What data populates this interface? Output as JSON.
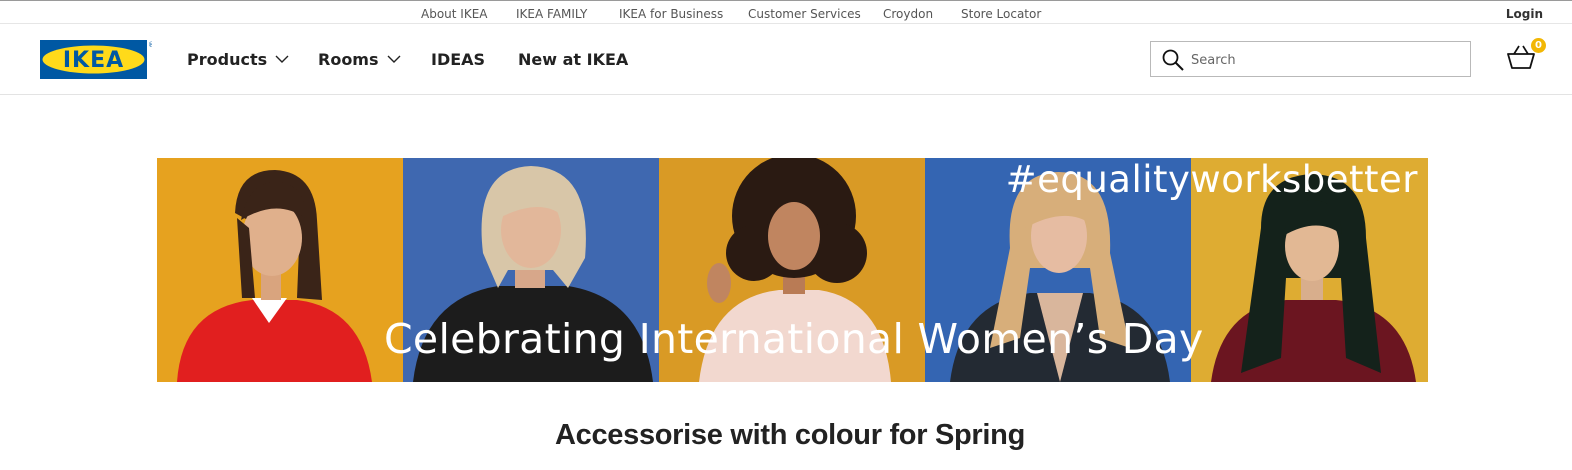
{
  "utility_nav": {
    "links": [
      "About IKEA",
      "IKEA FAMILY",
      "IKEA for Business",
      "Customer Services",
      "Croydon",
      "Store Locator"
    ],
    "login_label": "Login"
  },
  "header": {
    "logo_text": "IKEA",
    "nav": [
      {
        "label": "Products",
        "has_dropdown": true
      },
      {
        "label": "Rooms",
        "has_dropdown": true
      },
      {
        "label": "IDEAS",
        "has_dropdown": false
      },
      {
        "label": "New at IKEA",
        "has_dropdown": false
      }
    ],
    "search": {
      "placeholder": "Search",
      "value": ""
    },
    "cart": {
      "count": "0",
      "icon": "shopping-basket-icon"
    }
  },
  "hero": {
    "hashtag": "#equalityworksbetter",
    "caption": "Celebrating International Women’s Day",
    "panel_colors": [
      "#e6a21f",
      "#3f68b0",
      "#d99a25",
      "#3465b2",
      "#deac32"
    ]
  },
  "section": {
    "title": "Accessorise with colour for Spring"
  },
  "colors": {
    "brand_blue": "#0058a3",
    "brand_yellow": "#ffda1a",
    "badge": "#f2b705"
  }
}
